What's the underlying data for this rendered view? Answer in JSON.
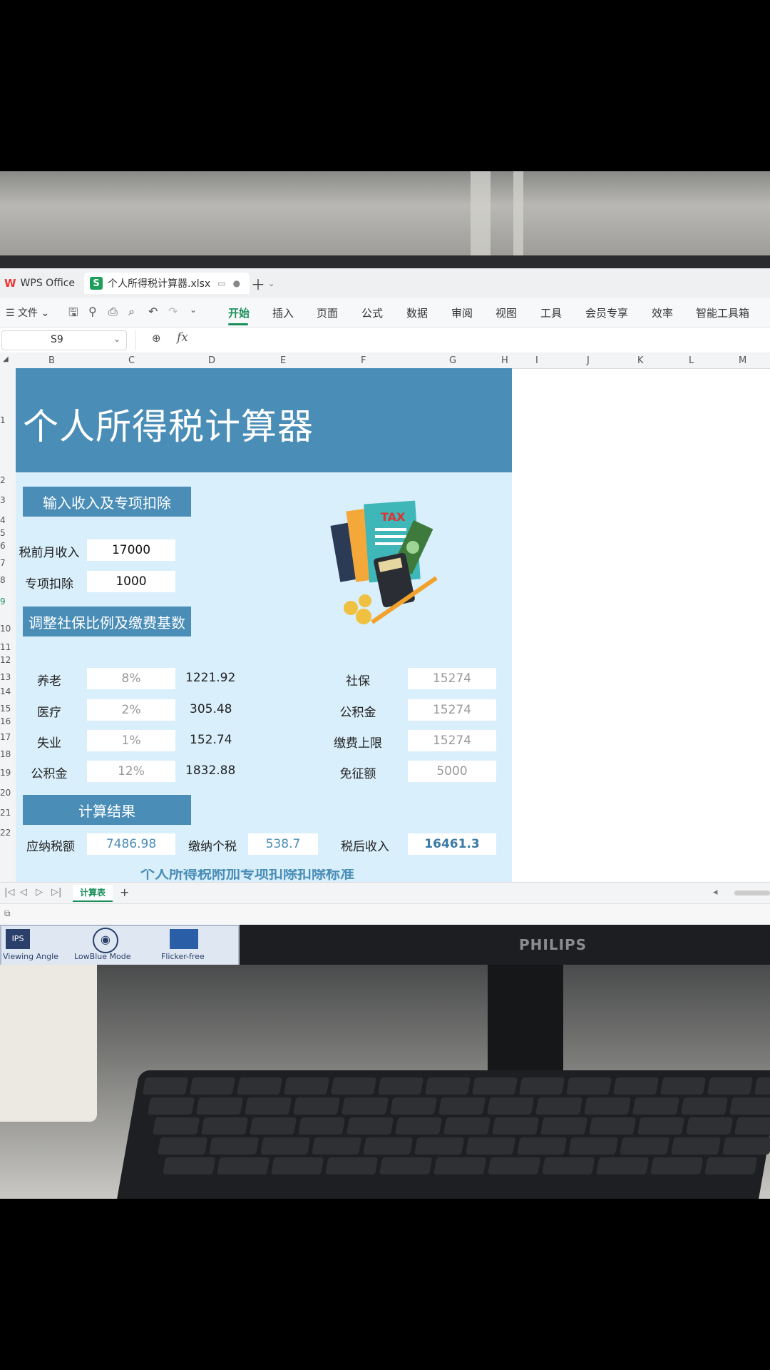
{
  "titlebar": {
    "app_tab": "WPS Office",
    "file_tab": "个人所得税计算器.xlsx"
  },
  "ribbon": {
    "menu": "文件",
    "tabs": [
      "开始",
      "插入",
      "页面",
      "公式",
      "数据",
      "审阅",
      "视图",
      "工具",
      "会员专享",
      "效率",
      "智能工具箱"
    ]
  },
  "formula_bar": {
    "cell_ref": "S9",
    "fx": "fx"
  },
  "columns": [
    "B",
    "C",
    "D",
    "E",
    "F",
    "G",
    "H",
    "I",
    "J",
    "K",
    "L",
    "M"
  ],
  "rows": [
    "1",
    "2",
    "3",
    "4",
    "5",
    "6",
    "7",
    "8",
    "9",
    "10",
    "11",
    "12",
    "13",
    "14",
    "15",
    "16",
    "17",
    "18",
    "19",
    "20",
    "21",
    "22"
  ],
  "sheet": {
    "title": "个人所得税计算器",
    "section_input": "输入收入及专项扣除",
    "pretax_label": "税前月收入",
    "pretax_value": "17000",
    "deduction_label": "专项扣除",
    "deduction_value": "1000",
    "section_insurance": "调整社保比例及缴费基数",
    "insurance": [
      {
        "label": "养老",
        "rate": "8%",
        "amount": "1221.92"
      },
      {
        "label": "医疗",
        "rate": "2%",
        "amount": "305.48"
      },
      {
        "label": "失业",
        "rate": "1%",
        "amount": "152.74"
      },
      {
        "label": "公积金",
        "rate": "12%",
        "amount": "1832.88"
      }
    ],
    "bases": [
      {
        "label": "社保",
        "value": "15274"
      },
      {
        "label": "公积金",
        "value": "15274"
      },
      {
        "label": "缴费上限",
        "value": "15274"
      },
      {
        "label": "免征额",
        "value": "5000"
      }
    ],
    "section_result": "计算结果",
    "taxable_label": "应纳税额",
    "taxable_value": "7486.98",
    "tax_label": "缴纳个税",
    "tax_value": "538.7",
    "aftertax_label": "税后收入",
    "aftertax_value": "16461.3",
    "next_section_partial": "个人所得税附加专项扣除扣除标准",
    "illustration_label": "TAX"
  },
  "sheet_tabs": {
    "active": "计算表",
    "add": "+"
  },
  "monitor": {
    "brand": "PHILIPS",
    "features": [
      "Viewing Angle",
      "LowBlue Mode",
      "Flicker-free"
    ]
  }
}
